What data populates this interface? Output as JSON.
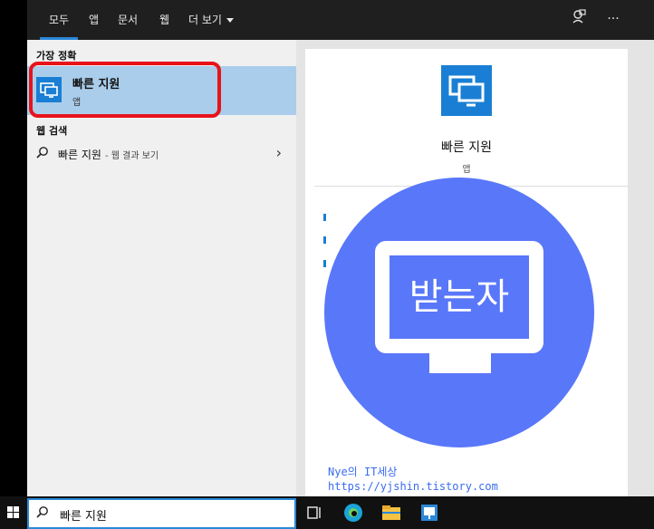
{
  "tabs": [
    "모두",
    "앱",
    "문서",
    "웹",
    "더 보기"
  ],
  "best_match": {
    "section_label": "가장 정확",
    "title": "빠른 지원",
    "subtitle": "앱"
  },
  "web_search": {
    "section_label": "웹 검색",
    "query": "빠른 지원",
    "hint": "- 웹 결과 보기"
  },
  "preview": {
    "title": "빠른 지원",
    "kind": "앱"
  },
  "overlay": {
    "screen_text": "받는자",
    "watermark_line1": "Nye의 IT세상",
    "watermark_line2": "https://yjshin.tistory.com"
  },
  "taskbar": {
    "search_value": "빠른 지원"
  },
  "colors": {
    "accent": "#2b88d8",
    "app_icon": "#1a7fd4",
    "selected_bg": "#a9cdea",
    "highlight_border": "#e8131a",
    "overlay_blue": "#5977f9"
  }
}
